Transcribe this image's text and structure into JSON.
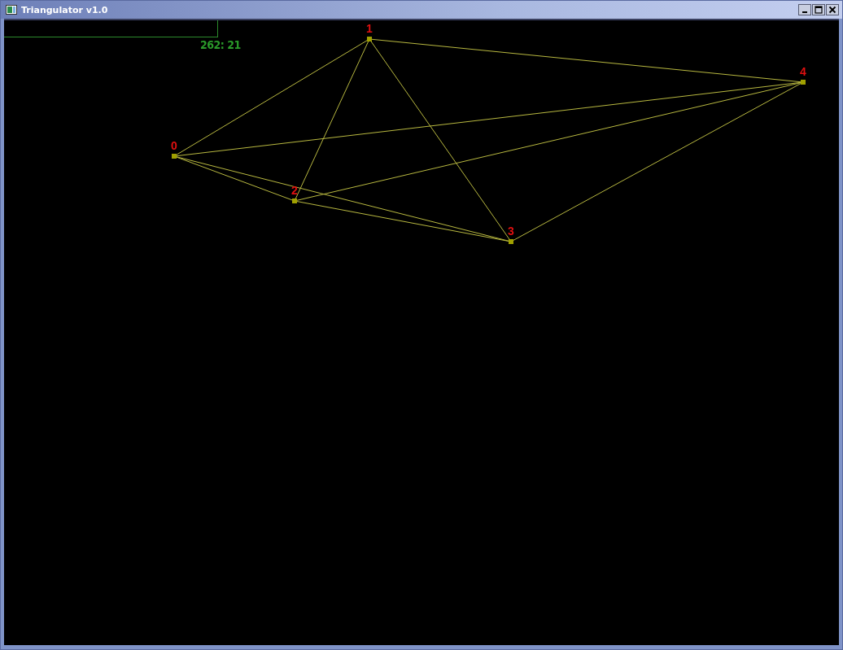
{
  "window": {
    "title": "Triangulator v1.0"
  },
  "readout": "262: 21",
  "nodes": [
    {
      "label": "0"
    },
    {
      "label": "1"
    },
    {
      "label": "2"
    },
    {
      "label": "3"
    },
    {
      "label": "4"
    }
  ]
}
